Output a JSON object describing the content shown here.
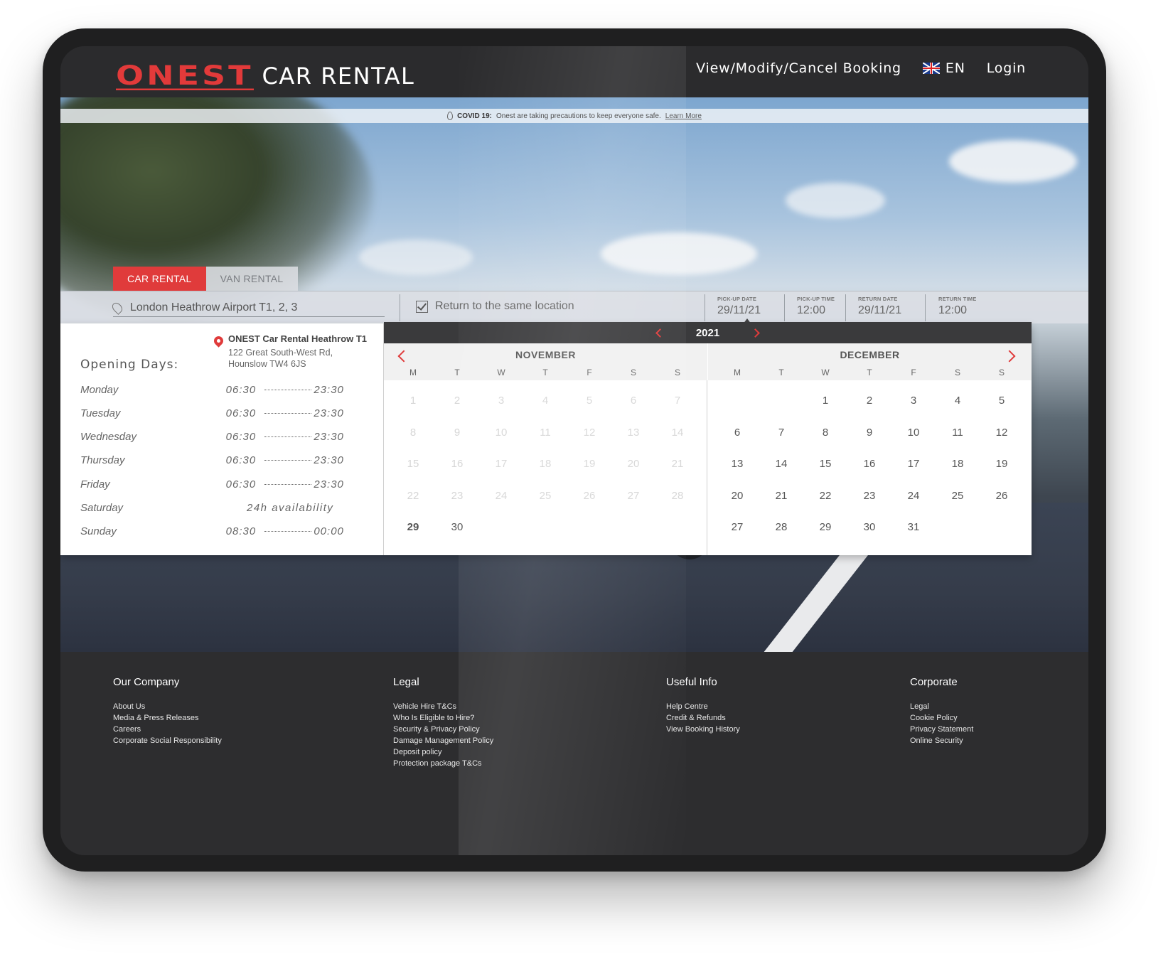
{
  "header": {
    "logo_mark": "ONEST",
    "logo_text": "CAR RENTAL",
    "nav_booking": "View/Modify/Cancel Booking",
    "language": "EN",
    "login": "Login"
  },
  "covid": {
    "label": "COVID 19:",
    "text": "Onest are taking precautions to keep everyone safe.",
    "link": "Learn More"
  },
  "tabs": [
    "CAR RENTAL",
    "VAN RENTAL"
  ],
  "search": {
    "location": "London Heathrow Airport T1, 2, 3",
    "same_location": "Return to the same location",
    "pickup_date_label": "PICK-UP DATE",
    "pickup_date": "29/11/21",
    "pickup_time_label": "PICK-UP TIME",
    "pickup_time": "12:00",
    "return_date_label": "RETURN DATE",
    "return_date": "29/11/21",
    "return_time_label": "RETURN TIME",
    "return_time": "12:00"
  },
  "branch": {
    "name": "ONEST Car Rental Heathrow T1",
    "address_line1": "122 Great South-West Rd,",
    "address_line2": "Hounslow TW4 6JS"
  },
  "opening": {
    "title": "Opening Days:",
    "days": [
      {
        "day": "Monday",
        "open": "06:30",
        "close": "23:30"
      },
      {
        "day": "Tuesday",
        "open": "06:30",
        "close": "23:30"
      },
      {
        "day": "Wednesday",
        "open": "06:30",
        "close": "23:30"
      },
      {
        "day": "Thursday",
        "open": "06:30",
        "close": "23:30"
      },
      {
        "day": "Friday",
        "open": "06:30",
        "close": "23:30"
      },
      {
        "day": "Saturday",
        "availability": "24h availability"
      },
      {
        "day": "Sunday",
        "open": "08:30",
        "close": "00:00"
      }
    ]
  },
  "calendar": {
    "year": "2021",
    "weekdays": [
      "M",
      "T",
      "W",
      "T",
      "F",
      "S",
      "S"
    ],
    "months": [
      {
        "name": "NOVEMBER",
        "offset": 0,
        "days": 30,
        "past_until": 28,
        "selected": 29
      },
      {
        "name": "DECEMBER",
        "offset": 2,
        "days": 31,
        "past_until": 0,
        "selected": null
      }
    ]
  },
  "footer": {
    "columns": [
      {
        "title": "Our Company",
        "links": [
          "About Us",
          "Media & Press Releases",
          "Careers",
          "Corporate Social Responsibility"
        ]
      },
      {
        "title": "Legal",
        "links": [
          "Vehicle Hire T&Cs",
          "Who Is Eligible to Hire?",
          "Security & Privacy Policy",
          "Damage Management Policy",
          "Deposit policy",
          "Protection package T&Cs"
        ]
      },
      {
        "title": "Useful Info",
        "links": [
          "Help Centre",
          "Credit & Refunds",
          "View Booking History"
        ]
      },
      {
        "title": "Corporate",
        "links": [
          "Legal",
          "Cookie Policy",
          "Privacy Statement",
          "Online Security"
        ]
      }
    ]
  },
  "colors": {
    "accent": "#e03b3b",
    "header_bg": "#2b2b2d",
    "footer_bg": "#2d2d2f"
  }
}
